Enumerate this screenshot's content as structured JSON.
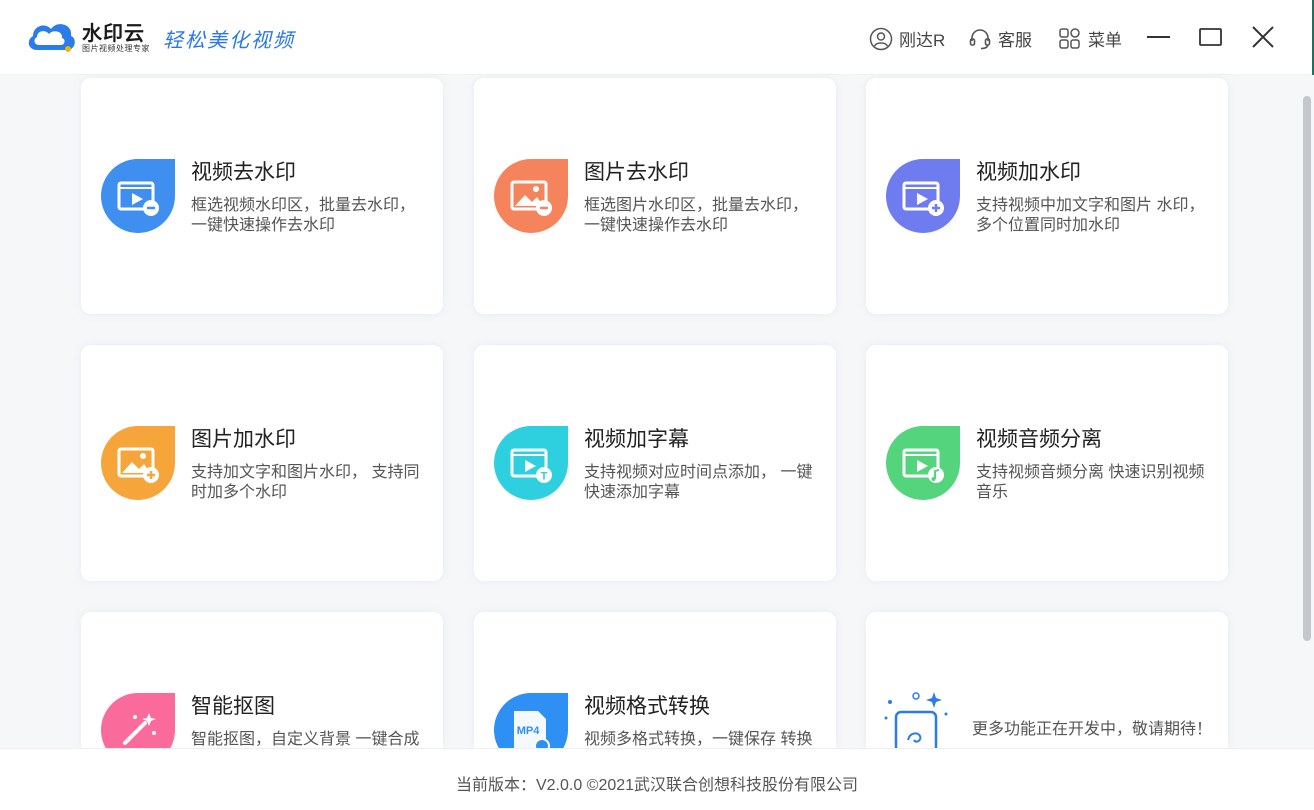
{
  "header": {
    "logo_name": "水印云",
    "logo_sub": "图片视频处理专家",
    "slogan": "轻松美化视频",
    "user_label": "刚达R",
    "service_label": "客服",
    "menu_label": "菜单"
  },
  "cards": [
    {
      "title": "视频去水印",
      "desc": "框选视频水印区，批量去水印， 一键快速操作去水印",
      "icon": "video-remove-watermark-icon",
      "color": "#3f8ff0"
    },
    {
      "title": "图片去水印",
      "desc": "框选图片水印区，批量去水印， 一键快速操作去水印",
      "icon": "image-remove-watermark-icon",
      "color": "#f5845d"
    },
    {
      "title": "视频加水印",
      "desc": "支持视频中加文字和图片 水印，多个位置同时加水印",
      "icon": "video-add-watermark-icon",
      "color": "#6f7cf0"
    },
    {
      "title": "图片加水印",
      "desc": "支持加文字和图片水印， 支持同时加多个水印",
      "icon": "image-add-watermark-icon",
      "color": "#f6a53a"
    },
    {
      "title": "视频加字幕",
      "desc": "支持视频对应时间点添加， 一键快速添加字幕",
      "icon": "video-subtitle-icon",
      "color": "#2ed0e0"
    },
    {
      "title": "视频音频分离",
      "desc": "支持视频音频分离 快速识别视频音乐",
      "icon": "audio-separate-icon",
      "color": "#55d47e"
    },
    {
      "title": "智能抠图",
      "desc": "智能抠图，自定义背景 一键合成",
      "icon": "smart-cutout-icon",
      "color": "#fa6a9a"
    },
    {
      "title": "视频格式转换",
      "desc": "视频多格式转换，一键保存 转换",
      "icon": "mp4-format-icon",
      "color": "#2e8ff5"
    }
  ],
  "more": {
    "desc": "更多功能正在开发中，敬请期待！",
    "icon": "coming-soon-icon"
  },
  "footer": {
    "text": "当前版本：V2.0.0 ©2021武汉联合创想科技股份有限公司"
  }
}
